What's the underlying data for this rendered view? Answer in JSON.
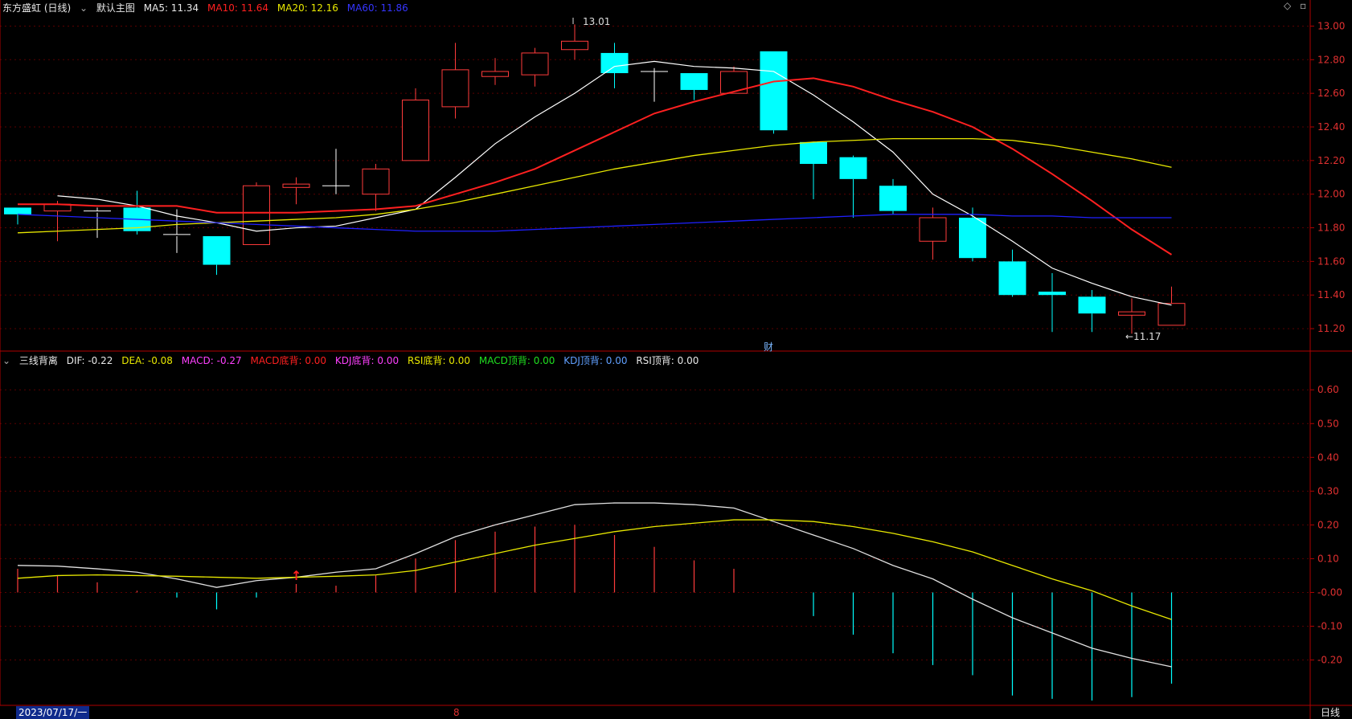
{
  "header": {
    "stock_name": "东方盛虹 (日线)",
    "main_chart_label": "默认主图",
    "ma5": "MA5: 11.34",
    "ma10": "MA10: 11.64",
    "ma20": "MA20: 12.16",
    "ma60": "MA60: 11.86"
  },
  "indicator_header": {
    "name": "三线背离",
    "dif": "DIF: -0.22",
    "dea": "DEA: -0.08",
    "macd": "MACD: -0.27",
    "macd_bottom": "MACD底背: 0.00",
    "kdj_bottom": "KDJ底背: 0.00",
    "rsi_bottom": "RSI底背: 0.00",
    "macd_top": "MACD顶背: 0.00",
    "kdj_top": "KDJ顶背: 0.00",
    "rsi_top": "RSI顶背: 0.00"
  },
  "footer": {
    "date_label": "2023/07/17/一",
    "month_mark": "8",
    "period_label": "日线"
  },
  "marks": {
    "cai": "财",
    "high_label": "13.01",
    "low_label": "←11.17"
  },
  "colors": {
    "up": "#ff3b3b",
    "down": "#00ffff",
    "ma5": "#ffffff",
    "ma10": "#ff2020",
    "ma20": "#e8e800",
    "ma60": "#2020ff",
    "dif": "#e0e0e0",
    "dea": "#e8e800",
    "axis": "#b00000"
  },
  "chart_data": [
    {
      "type": "candlestick",
      "ylim": [
        11.1,
        13.05
      ],
      "y_ticks": [
        "13.00",
        "12.80",
        "12.60",
        "12.40",
        "12.20",
        "12.00",
        "11.80",
        "11.60",
        "11.40",
        "11.20"
      ],
      "candles": [
        {
          "o": 11.92,
          "h": 11.92,
          "l": 11.82,
          "c": 11.88
        },
        {
          "o": 11.9,
          "h": 11.96,
          "l": 11.72,
          "c": 11.94
        },
        {
          "o": 11.9,
          "h": 11.92,
          "l": 11.74,
          "c": 11.89
        },
        {
          "o": 11.92,
          "h": 12.02,
          "l": 11.76,
          "c": 11.78
        },
        {
          "o": 11.76,
          "h": 11.91,
          "l": 11.65,
          "c": 11.75
        },
        {
          "o": 11.75,
          "h": 11.75,
          "l": 11.52,
          "c": 11.58
        },
        {
          "o": 11.7,
          "h": 12.07,
          "l": 11.7,
          "c": 12.05
        },
        {
          "o": 12.04,
          "h": 12.1,
          "l": 11.94,
          "c": 12.06
        },
        {
          "o": 12.05,
          "h": 12.27,
          "l": 12.0,
          "c": 12.05
        },
        {
          "o": 12.0,
          "h": 12.18,
          "l": 11.9,
          "c": 12.15
        },
        {
          "o": 12.2,
          "h": 12.63,
          "l": 12.2,
          "c": 12.56
        },
        {
          "o": 12.52,
          "h": 12.9,
          "l": 12.45,
          "c": 12.74
        },
        {
          "o": 12.7,
          "h": 12.81,
          "l": 12.65,
          "c": 12.73
        },
        {
          "o": 12.71,
          "h": 12.87,
          "l": 12.64,
          "c": 12.84
        },
        {
          "o": 12.86,
          "h": 13.01,
          "l": 12.8,
          "c": 12.91
        },
        {
          "o": 12.84,
          "h": 12.9,
          "l": 12.63,
          "c": 12.72
        },
        {
          "o": 12.73,
          "h": 12.75,
          "l": 12.55,
          "c": 12.73
        },
        {
          "o": 12.72,
          "h": 12.72,
          "l": 12.56,
          "c": 12.62
        },
        {
          "o": 12.6,
          "h": 12.76,
          "l": 12.6,
          "c": 12.73
        },
        {
          "o": 12.85,
          "h": 12.85,
          "l": 12.36,
          "c": 12.38
        },
        {
          "o": 12.31,
          "h": 12.31,
          "l": 11.97,
          "c": 12.18
        },
        {
          "o": 12.22,
          "h": 12.23,
          "l": 11.86,
          "c": 12.09
        },
        {
          "o": 12.05,
          "h": 12.09,
          "l": 11.88,
          "c": 11.9
        },
        {
          "o": 11.72,
          "h": 11.92,
          "l": 11.61,
          "c": 11.86
        },
        {
          "o": 11.86,
          "h": 11.92,
          "l": 11.6,
          "c": 11.62
        },
        {
          "o": 11.6,
          "h": 11.67,
          "l": 11.39,
          "c": 11.4
        },
        {
          "o": 11.42,
          "h": 11.53,
          "l": 11.18,
          "c": 11.4
        },
        {
          "o": 11.39,
          "h": 11.43,
          "l": 11.18,
          "c": 11.29
        },
        {
          "o": 11.28,
          "h": 11.38,
          "l": 11.17,
          "c": 11.3
        },
        {
          "o": 11.22,
          "h": 11.45,
          "l": 11.22,
          "c": 11.35
        }
      ],
      "series": [
        {
          "name": "MA5",
          "values": [
            11.99,
            11.97,
            11.93,
            11.87,
            11.83,
            11.78,
            11.8,
            11.81,
            11.86,
            11.91,
            12.1,
            12.3,
            12.46,
            12.6,
            12.76,
            12.79,
            12.76,
            12.75,
            12.73,
            12.59,
            12.43,
            12.25,
            12.0,
            11.87,
            11.72,
            11.56,
            11.47,
            11.39,
            11.34
          ]
        },
        {
          "name": "MA10",
          "values": [
            11.94,
            11.94,
            11.93,
            11.93,
            11.93,
            11.89,
            11.89,
            11.89,
            11.9,
            11.91,
            11.93,
            12.0,
            12.07,
            12.15,
            12.26,
            12.37,
            12.48,
            12.55,
            12.61,
            12.67,
            12.69,
            12.64,
            12.56,
            12.49,
            12.4,
            12.27,
            12.12,
            11.96,
            11.79,
            11.64
          ]
        },
        {
          "name": "MA20",
          "values": [
            11.77,
            11.78,
            11.79,
            11.8,
            11.82,
            11.83,
            11.84,
            11.85,
            11.86,
            11.88,
            11.91,
            11.95,
            12.0,
            12.05,
            12.1,
            12.15,
            12.19,
            12.23,
            12.26,
            12.29,
            12.31,
            12.32,
            12.33,
            12.33,
            12.33,
            12.32,
            12.29,
            12.25,
            12.21,
            12.16
          ]
        },
        {
          "name": "MA60",
          "values": [
            11.88,
            11.87,
            11.86,
            11.85,
            11.84,
            11.83,
            11.82,
            11.81,
            11.8,
            11.79,
            11.78,
            11.78,
            11.78,
            11.79,
            11.8,
            11.81,
            11.82,
            11.83,
            11.84,
            11.85,
            11.86,
            11.87,
            11.88,
            11.88,
            11.88,
            11.87,
            11.87,
            11.86,
            11.86,
            11.86
          ]
        }
      ]
    },
    {
      "type": "bar",
      "ylim": [
        -0.32,
        0.66
      ],
      "y_ticks": [
        "0.60",
        "0.50",
        "0.40",
        "0.30",
        "0.20",
        "0.10",
        "-0.00",
        "-0.10",
        "-0.20"
      ],
      "macd": [
        0.07,
        0.05,
        0.03,
        0.005,
        -0.015,
        -0.05,
        -0.015,
        0.025,
        0.02,
        0.05,
        0.1,
        0.155,
        0.18,
        0.195,
        0.2,
        0.17,
        0.135,
        0.095,
        0.07,
        0,
        -0.07,
        -0.125,
        -0.18,
        -0.215,
        -0.245,
        -0.305,
        -0.315,
        -0.32,
        -0.31,
        -0.27
      ],
      "series": [
        {
          "name": "DIF",
          "values": [
            0.08,
            0.078,
            0.07,
            0.06,
            0.04,
            0.015,
            0.035,
            0.045,
            0.06,
            0.07,
            0.115,
            0.165,
            0.2,
            0.23,
            0.26,
            0.265,
            0.265,
            0.26,
            0.25,
            0.21,
            0.17,
            0.13,
            0.08,
            0.04,
            -0.02,
            -0.075,
            -0.12,
            -0.165,
            -0.195,
            -0.22
          ]
        },
        {
          "name": "DEA",
          "values": [
            0.042,
            0.05,
            0.052,
            0.05,
            0.048,
            0.045,
            0.042,
            0.045,
            0.048,
            0.052,
            0.065,
            0.09,
            0.115,
            0.14,
            0.16,
            0.18,
            0.195,
            0.205,
            0.215,
            0.215,
            0.21,
            0.195,
            0.175,
            0.15,
            0.12,
            0.08,
            0.04,
            0.005,
            -0.04,
            -0.08
          ]
        }
      ]
    }
  ]
}
